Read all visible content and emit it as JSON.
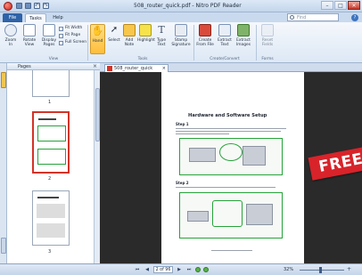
{
  "window": {
    "title": "508_router_quick.pdf - Nitro PDF Reader",
    "controls": [
      "–",
      "□",
      "✕"
    ]
  },
  "tabs": {
    "file": "File",
    "items": [
      "Tasks",
      "Help"
    ],
    "active": "Tasks"
  },
  "search": {
    "placeholder": "Find",
    "help": "?"
  },
  "ribbon": {
    "view_group": {
      "label": "View",
      "zoom_in": "Zoom In",
      "rotate_view": "Rotate View",
      "display_pages": "Display Pages",
      "fit_width": "Fit Width",
      "fit_page": "Fit Page",
      "full_screen": "Full Screen"
    },
    "tools_group": {
      "label": "Tools",
      "hand": "Hand",
      "select": "Select",
      "add_note": "Add Note",
      "highlight": "Highlight",
      "type_text": "Type Text",
      "stamp_signature": "Stamp Signature"
    },
    "create_group": {
      "label": "Create/Convert",
      "create_from_file": "Create From File",
      "extract_text": "Extract Text",
      "extract_images": "Extract Images"
    },
    "forms_group": {
      "label": "Forms",
      "reset_fields": "Reset Fields"
    }
  },
  "panel": {
    "title": "Pages",
    "thumbnails": [
      {
        "number": "1",
        "selected": false
      },
      {
        "number": "2",
        "selected": true
      },
      {
        "number": "3",
        "selected": false
      }
    ]
  },
  "document": {
    "tab_label": "508_router_quick",
    "heading": "Hardware and Software Setup",
    "step1": "Step 1",
    "step2": "Step 2",
    "banner": "FREE"
  },
  "status": {
    "page_field": "2 of 96",
    "zoom": "32%"
  },
  "colors": {
    "accent": "#2f63a8",
    "selection": "#d43328",
    "banner": "#d8232a",
    "figure_border": "#27a23a"
  }
}
